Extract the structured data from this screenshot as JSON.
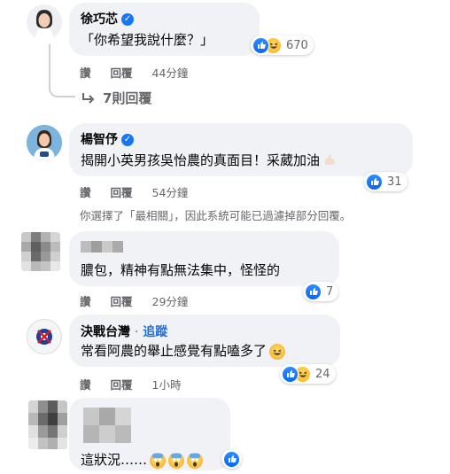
{
  "comments": [
    {
      "author": "徐巧芯",
      "verified": true,
      "text": "「你希望我說什麼？」",
      "reaction_count": "670",
      "reactions": [
        "like-icon",
        "haha-icon"
      ],
      "actions": {
        "like": "讚",
        "reply": "回覆",
        "time": "44分鐘"
      },
      "replies_link": "7則回覆"
    },
    {
      "author": "楊智伃",
      "verified": true,
      "text": "揭開小英男孩吳怡農的真面目！采葳加油",
      "reaction_count": "31",
      "reactions": [
        "like-icon"
      ],
      "actions": {
        "like": "讚",
        "reply": "回覆",
        "time": "54分鐘"
      }
    },
    {
      "author": "",
      "text": "膿包，精神有點無法集中，怪怪的",
      "reaction_count": "7",
      "reactions": [
        "like-icon"
      ],
      "actions": {
        "like": "讚",
        "reply": "回覆",
        "time": "29分鐘"
      }
    },
    {
      "author": "決戰台灣",
      "follow_label": "追蹤",
      "separator": "·",
      "text": "常看阿農的舉止感覺有點嗑多了",
      "reaction_count": "24",
      "reactions": [
        "like-icon",
        "haha-icon"
      ],
      "actions": {
        "like": "讚",
        "reply": "回覆",
        "time": "1小時"
      }
    },
    {
      "author": "",
      "text": "這狀況……",
      "reactions": [
        "like-icon"
      ]
    }
  ],
  "notice": "你選擇了「最相關」，因此系統可能已過濾掉部分回覆。",
  "colors": {
    "like_blue": "#1877f2",
    "bubble_bg": "#f0f2f5",
    "meta_gray": "#65676b"
  }
}
